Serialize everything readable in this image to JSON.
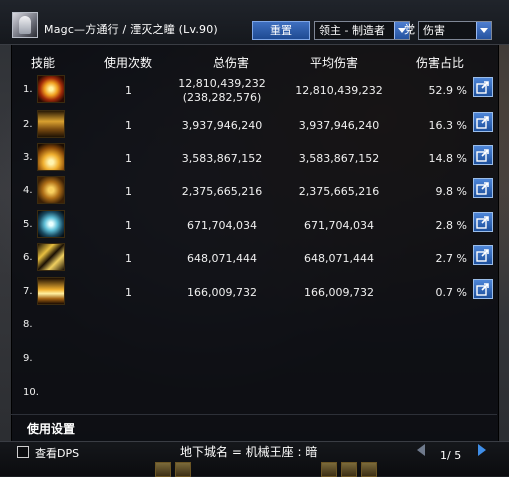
{
  "header": {
    "character": "Magc—方通行 / 湮灭之瞳 (Lv.90)",
    "reset_label": "重置",
    "dropdown1": "领主 - 制造者",
    "dropdown2": "伤害",
    "overlap_char": "党"
  },
  "columns": {
    "skill": "技能",
    "uses": "使用次数",
    "total": "总伤害",
    "avg": "平均伤害",
    "pct": "伤害占比"
  },
  "rows": [
    {
      "rank": "1.",
      "uses": "1",
      "total": "12,810,439,232",
      "total_sub": "(238,282,576)",
      "avg": "12,810,439,232",
      "pct": "52.9 %"
    },
    {
      "rank": "2.",
      "uses": "1",
      "total": "3,937,946,240",
      "total_sub": "",
      "avg": "3,937,946,240",
      "pct": "16.3 %"
    },
    {
      "rank": "3.",
      "uses": "1",
      "total": "3,583,867,152",
      "total_sub": "",
      "avg": "3,583,867,152",
      "pct": "14.8 %"
    },
    {
      "rank": "4.",
      "uses": "1",
      "total": "2,375,665,216",
      "total_sub": "",
      "avg": "2,375,665,216",
      "pct": "9.8 %"
    },
    {
      "rank": "5.",
      "uses": "1",
      "total": "671,704,034",
      "total_sub": "",
      "avg": "671,704,034",
      "pct": "2.8 %"
    },
    {
      "rank": "6.",
      "uses": "1",
      "total": "648,071,444",
      "total_sub": "",
      "avg": "648,071,444",
      "pct": "2.7 %"
    },
    {
      "rank": "7.",
      "uses": "1",
      "total": "166,009,732",
      "total_sub": "",
      "avg": "166,009,732",
      "pct": "0.7 %"
    },
    {
      "rank": "8.",
      "uses": "",
      "total": "",
      "total_sub": "",
      "avg": "",
      "pct": ""
    },
    {
      "rank": "9.",
      "uses": "",
      "total": "",
      "total_sub": "",
      "avg": "",
      "pct": ""
    },
    {
      "rank": "10.",
      "uses": "",
      "total": "",
      "total_sub": "",
      "avg": "",
      "pct": ""
    }
  ],
  "footer": {
    "settings_label": "使用设置",
    "checkbox_label": "查看DPS",
    "dungeon": "地下城名 = 机械王座 : 暗",
    "page": "1/ 5"
  },
  "colors": {
    "accent": "#2a5fb0",
    "panel": "#06080c"
  }
}
